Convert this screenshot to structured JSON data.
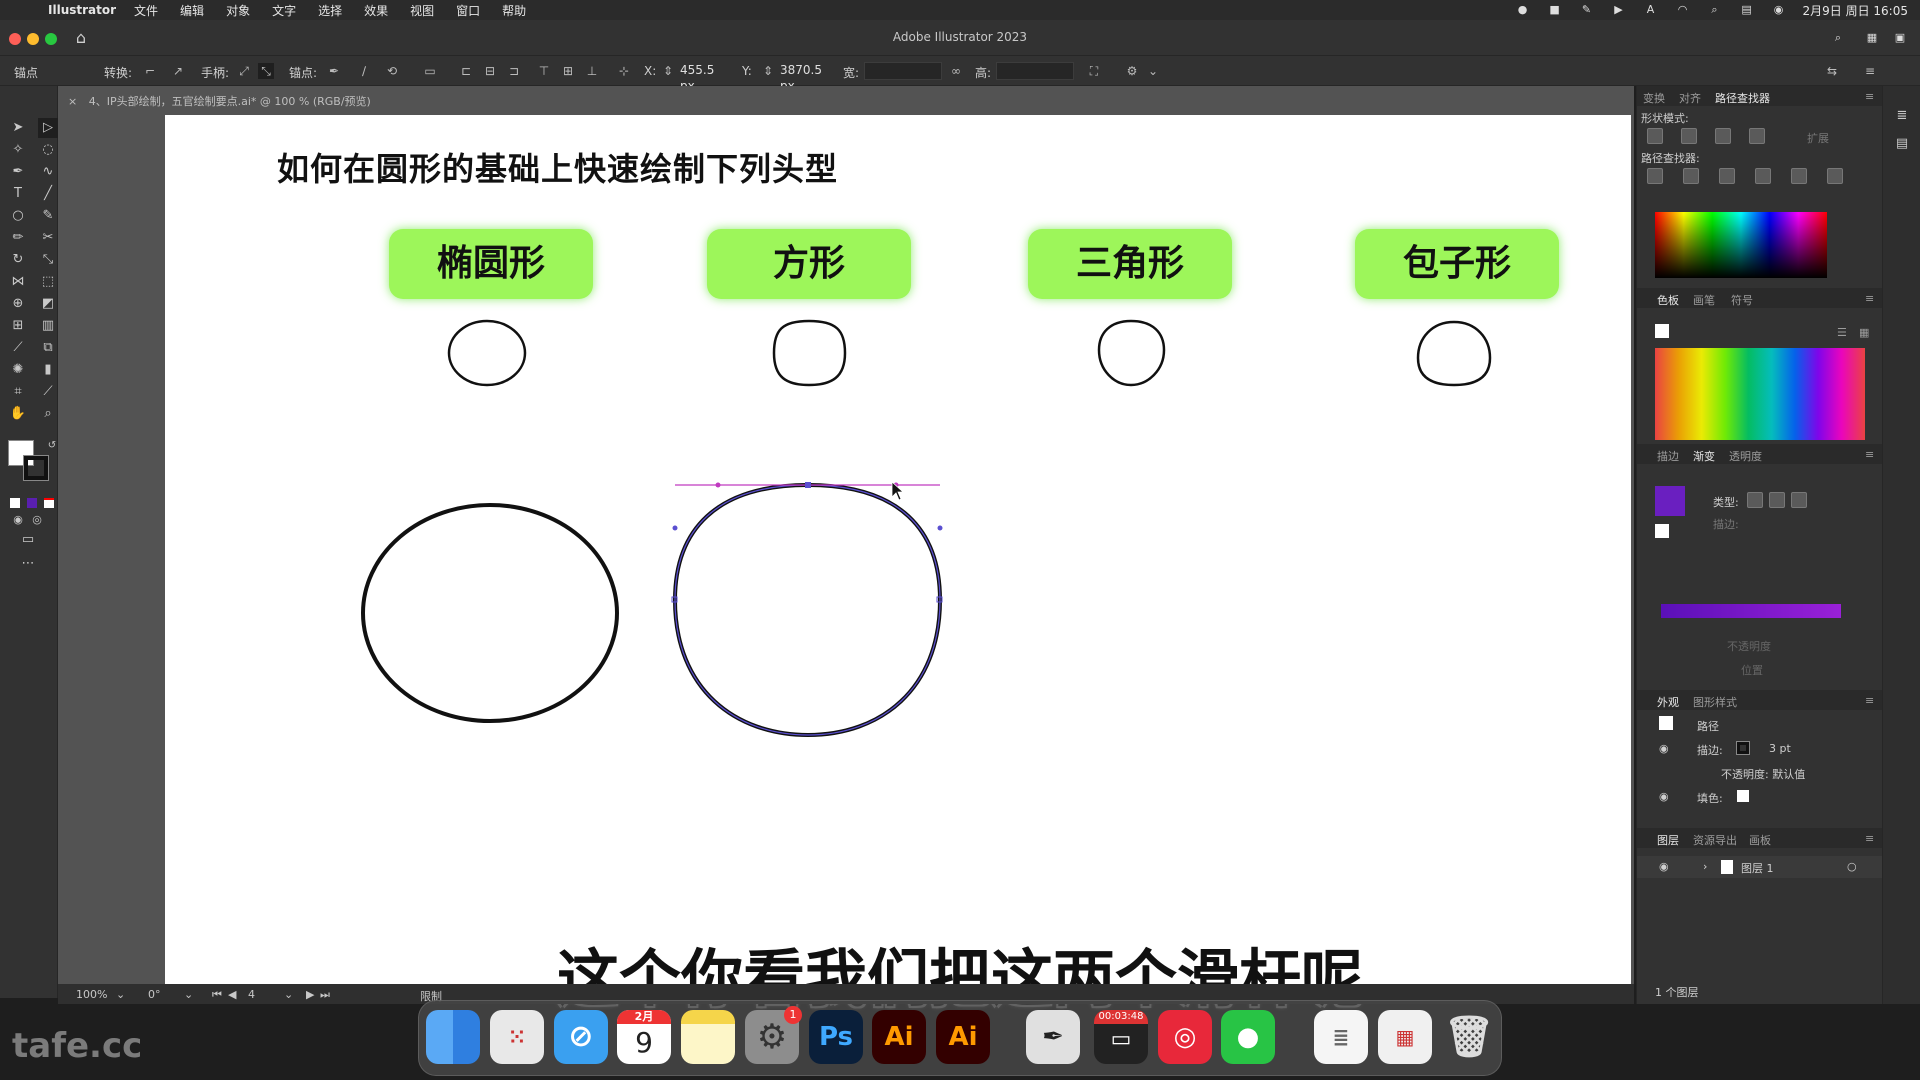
{
  "menubar": {
    "app_name": "Illustrator",
    "items": [
      "文件",
      "编辑",
      "对象",
      "文字",
      "选择",
      "效果",
      "视图",
      "窗口",
      "帮助"
    ],
    "datetime": "2月9日 周日 16:05"
  },
  "window": {
    "title": "Adobe Illustrator 2023"
  },
  "controlbar": {
    "mode_label": "锚点",
    "convert_label": "转换:",
    "handles_label": "手柄:",
    "anchors_label": "锚点:",
    "x_label": "X:",
    "x_value": "455.5 px",
    "y_label": "Y:",
    "y_value": "3870.5 px",
    "width_label": "宽:",
    "height_label": "高:"
  },
  "document": {
    "tab_label": "4、IP头部绘制，五官绘制要点.ai* @ 100 % (RGB/预览)"
  },
  "artboard": {
    "heading": "如何在圆形的基础上快速绘制下列头型",
    "shape_labels": [
      "椭圆形",
      "方形",
      "三角形",
      "包子形"
    ]
  },
  "subtitle": "这个你看我们把这两个滑杆呢",
  "statusbar": {
    "zoom": "100%",
    "rotation": "0°",
    "artboard_number": "4",
    "tool_status": "限制"
  },
  "panels": {
    "transform_tabs": [
      "变换",
      "对齐",
      "路径查找器"
    ],
    "shape_modes_label": "形状模式:",
    "expand_label": "扩展",
    "pathfinders_label": "路径查找器:",
    "swatch_tabs": [
      "色板",
      "画笔",
      "符号"
    ],
    "gradient_tabs": [
      "描边",
      "渐变",
      "透明度"
    ],
    "gradient_type_label": "类型:",
    "gradient_stroke_label": "描边:",
    "gradient_opacity_label": "不透明度",
    "gradient_location_label": "位置",
    "appearance_tabs": [
      "外观",
      "图形样式"
    ],
    "appearance_path": "路径",
    "appearance_stroke_label": "描边:",
    "appearance_stroke_value": "3 pt",
    "appearance_opacity": "不透明度: 默认值",
    "appearance_fill_label": "填色:",
    "layers_tabs": [
      "图层",
      "资源导出",
      "画板"
    ],
    "layer_name": "图层 1",
    "layers_count": "1 个图层"
  },
  "dock": {
    "calendar_month": "2月",
    "calendar_day": "9",
    "settings_badge": "1",
    "recording_time": "00:03:48",
    "apps": [
      "finder-icon",
      "launchpad-icon",
      "safari-icon",
      "calendar-icon",
      "notes-icon",
      "system-settings-icon",
      "photoshop-icon",
      "illustrator-icon",
      "illustrator-icon",
      "pen-app-icon",
      "recorder-icon",
      "netease-music-icon",
      "wechat-icon",
      "document-preview-icon",
      "screenshot-preview-icon",
      "trash-icon"
    ]
  },
  "watermark": "tafe.cc",
  "colors": {
    "label_green": "#9df65a",
    "selection_purple": "#7a3cb8",
    "gradient_purple": "#7a1cc4"
  }
}
